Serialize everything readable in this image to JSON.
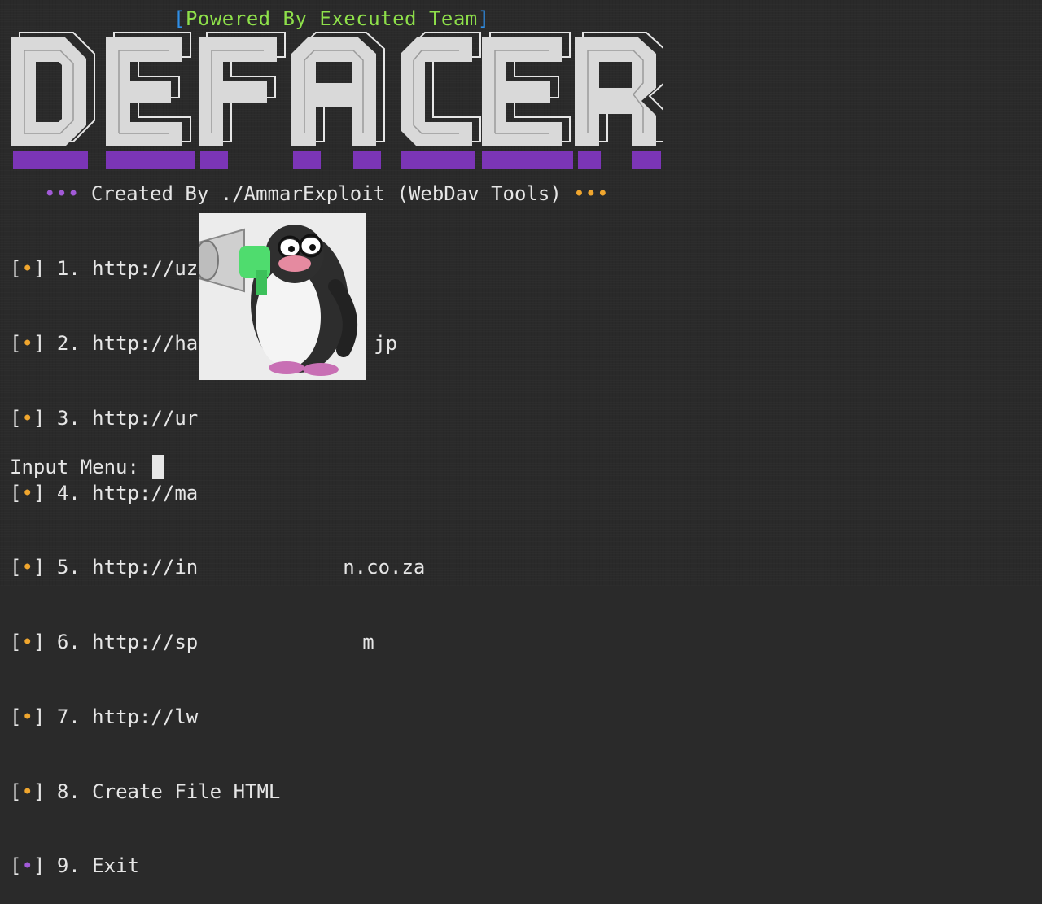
{
  "header": {
    "open_bracket": "[",
    "powered_text": "Powered By Executed Team",
    "close_bracket": "]"
  },
  "banner": {
    "logo_text": "DEFACER"
  },
  "credits": {
    "left_dots": "•••",
    "text": "Created By ./AmmarExploit (WebDav Tools)",
    "right_dots": "•••"
  },
  "menu": {
    "items": [
      {
        "number": "1.",
        "label": "http://uzi"
      },
      {
        "number": "2.",
        "label": "http://ha",
        "tail": "jp"
      },
      {
        "number": "3.",
        "label": "http://ur"
      },
      {
        "number": "4.",
        "label": "http://ma"
      },
      {
        "number": "5.",
        "label": "http://in",
        "tail": "n.co.za"
      },
      {
        "number": "6.",
        "label": "http://sp",
        "tail": "m"
      },
      {
        "number": "7.",
        "label": "http://lw"
      },
      {
        "number": "8.",
        "label": "Create File HTML"
      },
      {
        "number": "9.",
        "label": "Exit"
      }
    ]
  },
  "prompt": {
    "label": "Input Menu: "
  },
  "colors": {
    "background": "#2a2a2a",
    "accent_purple": "#a25ad8",
    "accent_orange": "#f0a62e",
    "powered_green": "#8ee04a",
    "bracket_blue": "#2f8ee6"
  }
}
